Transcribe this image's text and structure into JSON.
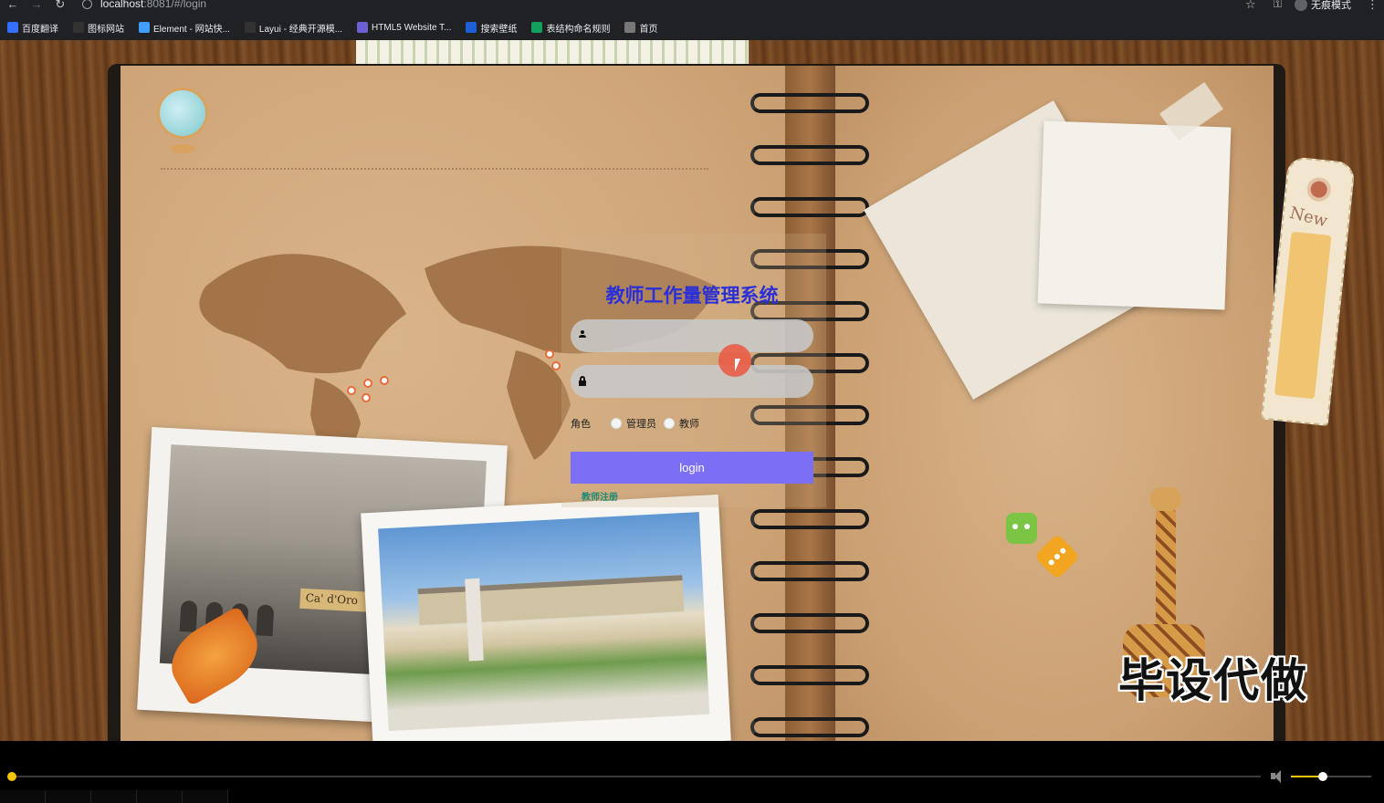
{
  "browser": {
    "url_host": "localhost",
    "url_rest": ":8081/#/login",
    "profile_label": "无痕模式",
    "bookmarks": [
      {
        "label": "百度翻译",
        "icon": "baidu-translate-icon",
        "color": "#3470f7"
      },
      {
        "label": "图标网站",
        "icon": "flag-icon",
        "color": "#333333"
      },
      {
        "label": "Element - 网站快...",
        "icon": "element-icon",
        "color": "#409eff"
      },
      {
        "label": "Layui - 经典开源模...",
        "icon": "layui-icon",
        "color": "#333333"
      },
      {
        "label": "HTML5 Website T...",
        "icon": "html5-icon",
        "color": "#6b5fd6"
      },
      {
        "label": "搜索壁纸",
        "icon": "wallpaper-icon",
        "color": "#1e5fd6"
      },
      {
        "label": "表结构命名规则",
        "icon": "table-icon",
        "color": "#12a05c"
      },
      {
        "label": "首页",
        "icon": "globe-icon",
        "color": "#777777"
      }
    ]
  },
  "login": {
    "title": "教师工作量管理系统",
    "username_placeholder": "",
    "password_placeholder": "",
    "role_label": "角色",
    "roles": [
      "管理员",
      "教师"
    ],
    "login_button": "login",
    "register_link": "教师注册"
  },
  "decor": {
    "photo_sign": "Ca' d'Oro",
    "tag_text": "New",
    "watermark": "毕设代做"
  },
  "player": {
    "progress": 0.0,
    "volume": 0.4
  },
  "colors": {
    "title": "#2a2fd8",
    "login_button": "#7b70f5",
    "register_link": "#1f8a74",
    "seek_accent": "#f5c400"
  }
}
